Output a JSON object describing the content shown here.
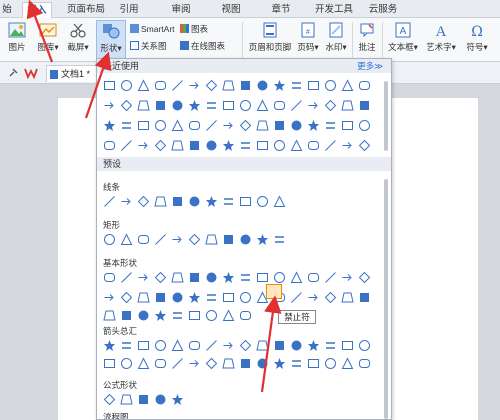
{
  "tabs": [
    {
      "label": "始",
      "active": false
    },
    {
      "label": "插入",
      "active": true
    },
    {
      "label": "页面布局",
      "active": false
    },
    {
      "label": "引用",
      "active": false
    },
    {
      "label": "审阅",
      "active": false
    },
    {
      "label": "视图",
      "active": false
    },
    {
      "label": "章节",
      "active": false
    },
    {
      "label": "开发工具",
      "active": false
    },
    {
      "label": "云服务",
      "active": false
    }
  ],
  "ribbon": {
    "picture": "图片",
    "gallery": "图库",
    "screenshot": "截屏",
    "shapes": "形状",
    "smartart": "SmartArt",
    "chart": "图表",
    "relation": "关系图",
    "online_chart": "在线图表",
    "header_footer": "页眉和页脚",
    "page_number": "页码",
    "watermark": "水印",
    "comment": "批注",
    "textbox": "文本框",
    "wordart": "艺术字",
    "symbol": "符号"
  },
  "quickbar": {
    "doc_tab": "文档1 *"
  },
  "panel": {
    "recent": "最近使用",
    "more": "更多≫",
    "presets": "预设",
    "categories": {
      "lines": "线条",
      "rect": "矩形",
      "basic": "基本形状",
      "arrows": "箭头总汇",
      "equation": "公式形状",
      "flowchart": "流程图"
    },
    "tooltip": "禁止符"
  },
  "colors": {
    "accent": "#2a6fd6",
    "shape_stroke": "#3a73c6",
    "arrow": "#e03030",
    "highlight": "#f08a00"
  }
}
